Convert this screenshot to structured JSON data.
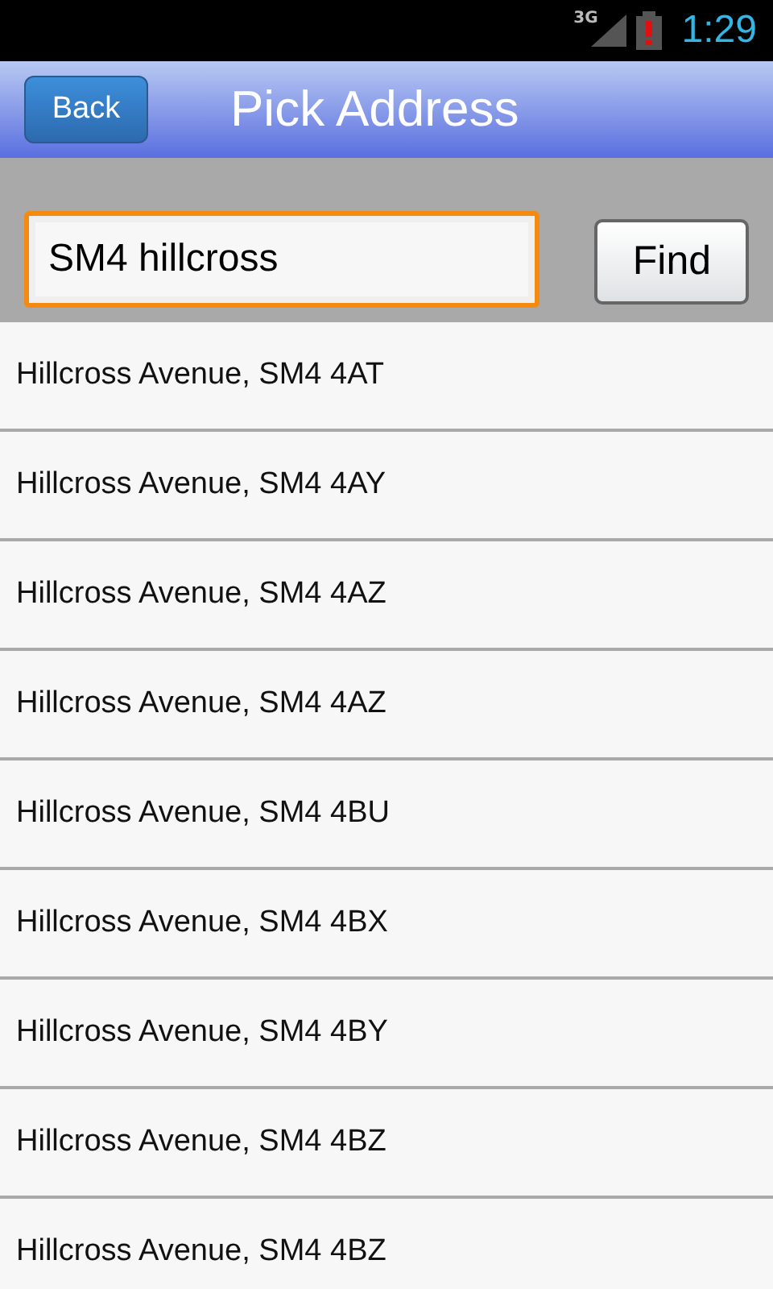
{
  "status_bar": {
    "network": "3G",
    "time": "1:29"
  },
  "header": {
    "back": "Back",
    "title": "Pick Address"
  },
  "search": {
    "value": "SM4 hillcross",
    "focused": true,
    "button": "Find"
  },
  "results": [
    {
      "text": "Hillcross Avenue, SM4 4AT"
    },
    {
      "text": "Hillcross Avenue, SM4 4AY"
    },
    {
      "text": "Hillcross Avenue, SM4 4AZ"
    },
    {
      "text": "Hillcross Avenue, SM4 4AZ"
    },
    {
      "text": "Hillcross Avenue, SM4 4BU"
    },
    {
      "text": "Hillcross Avenue, SM4 4BX"
    },
    {
      "text": "Hillcross Avenue, SM4 4BY"
    },
    {
      "text": "Hillcross Avenue, SM4 4BZ"
    },
    {
      "text": "Hillcross Avenue, SM4 4BZ"
    }
  ]
}
